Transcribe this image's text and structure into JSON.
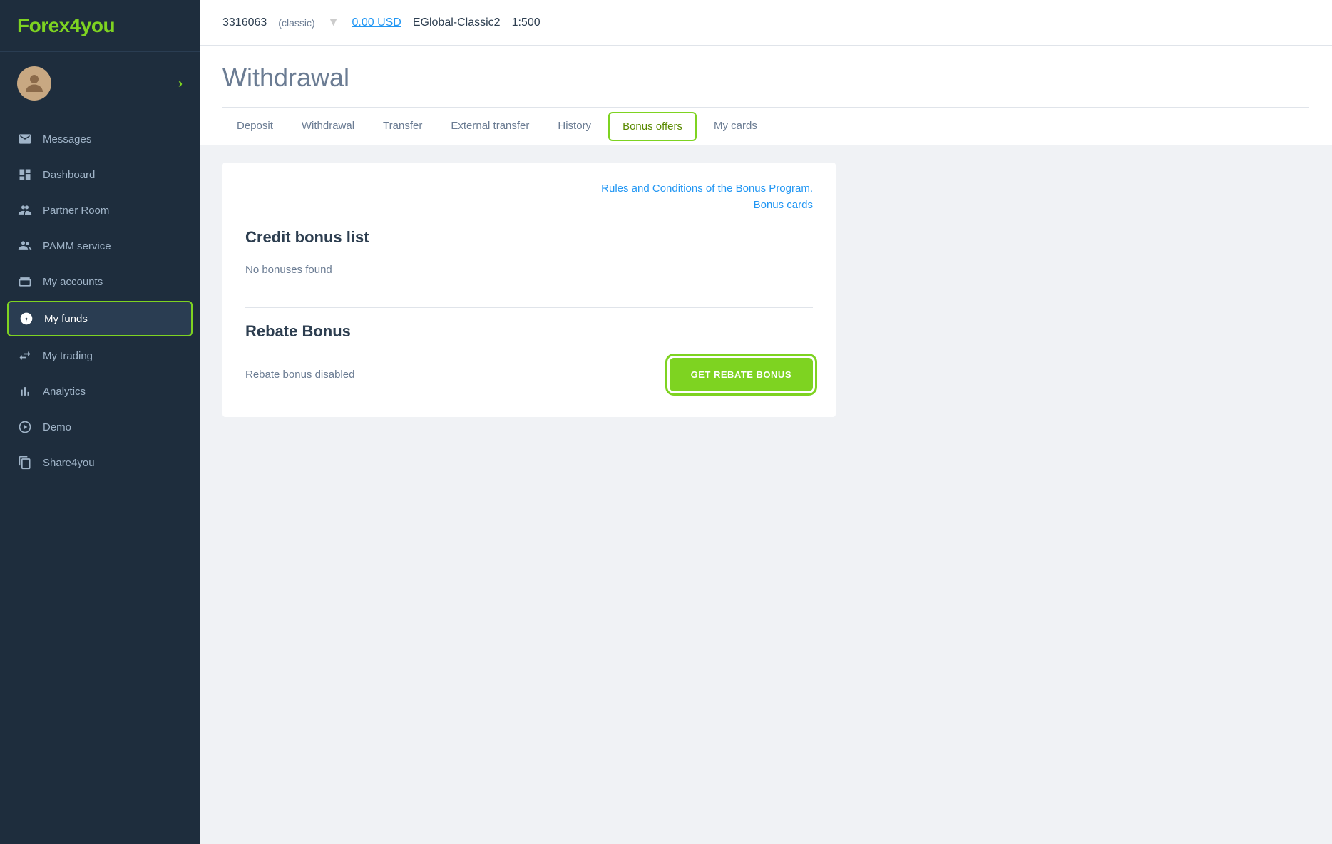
{
  "logo": {
    "text_before": "Forex",
    "number": "4",
    "text_after": "you"
  },
  "topbar": {
    "account_id": "3316063",
    "account_type": "(classic)",
    "balance": "0.00 USD",
    "server": "EGlobal-Classic2",
    "leverage": "1:500"
  },
  "sidebar": {
    "nav_items": [
      {
        "id": "messages",
        "label": "Messages",
        "icon": "envelope"
      },
      {
        "id": "dashboard",
        "label": "Dashboard",
        "icon": "dashboard"
      },
      {
        "id": "partner-room",
        "label": "Partner Room",
        "icon": "partner"
      },
      {
        "id": "pamm-service",
        "label": "PAMM service",
        "icon": "pamm"
      },
      {
        "id": "my-accounts",
        "label": "My accounts",
        "icon": "accounts"
      },
      {
        "id": "my-funds",
        "label": "My funds",
        "icon": "funds",
        "active": true
      },
      {
        "id": "my-trading",
        "label": "My trading",
        "icon": "trading"
      },
      {
        "id": "analytics",
        "label": "Analytics",
        "icon": "analytics"
      },
      {
        "id": "demo",
        "label": "Demo",
        "icon": "demo"
      },
      {
        "id": "share4you",
        "label": "Share4you",
        "icon": "share"
      }
    ]
  },
  "page": {
    "title": "Withdrawal"
  },
  "tabs": [
    {
      "id": "deposit",
      "label": "Deposit",
      "active": false
    },
    {
      "id": "withdrawal",
      "label": "Withdrawal",
      "active": false
    },
    {
      "id": "transfer",
      "label": "Transfer",
      "active": false
    },
    {
      "id": "external-transfer",
      "label": "External transfer",
      "active": false
    },
    {
      "id": "history",
      "label": "History",
      "active": false
    },
    {
      "id": "bonus-offers",
      "label": "Bonus offers",
      "active": true
    },
    {
      "id": "my-cards",
      "label": "My cards",
      "active": false
    }
  ],
  "bonus_section": {
    "rules_link": "Rules and Conditions of the Bonus Program.",
    "bonus_cards_link": "Bonus cards",
    "credit_bonus_title": "Credit bonus list",
    "no_bonus_text": "No bonuses found",
    "rebate_title": "Rebate Bonus",
    "rebate_status": "Rebate bonus disabled",
    "get_rebate_btn": "GET REBATE BONUS"
  }
}
